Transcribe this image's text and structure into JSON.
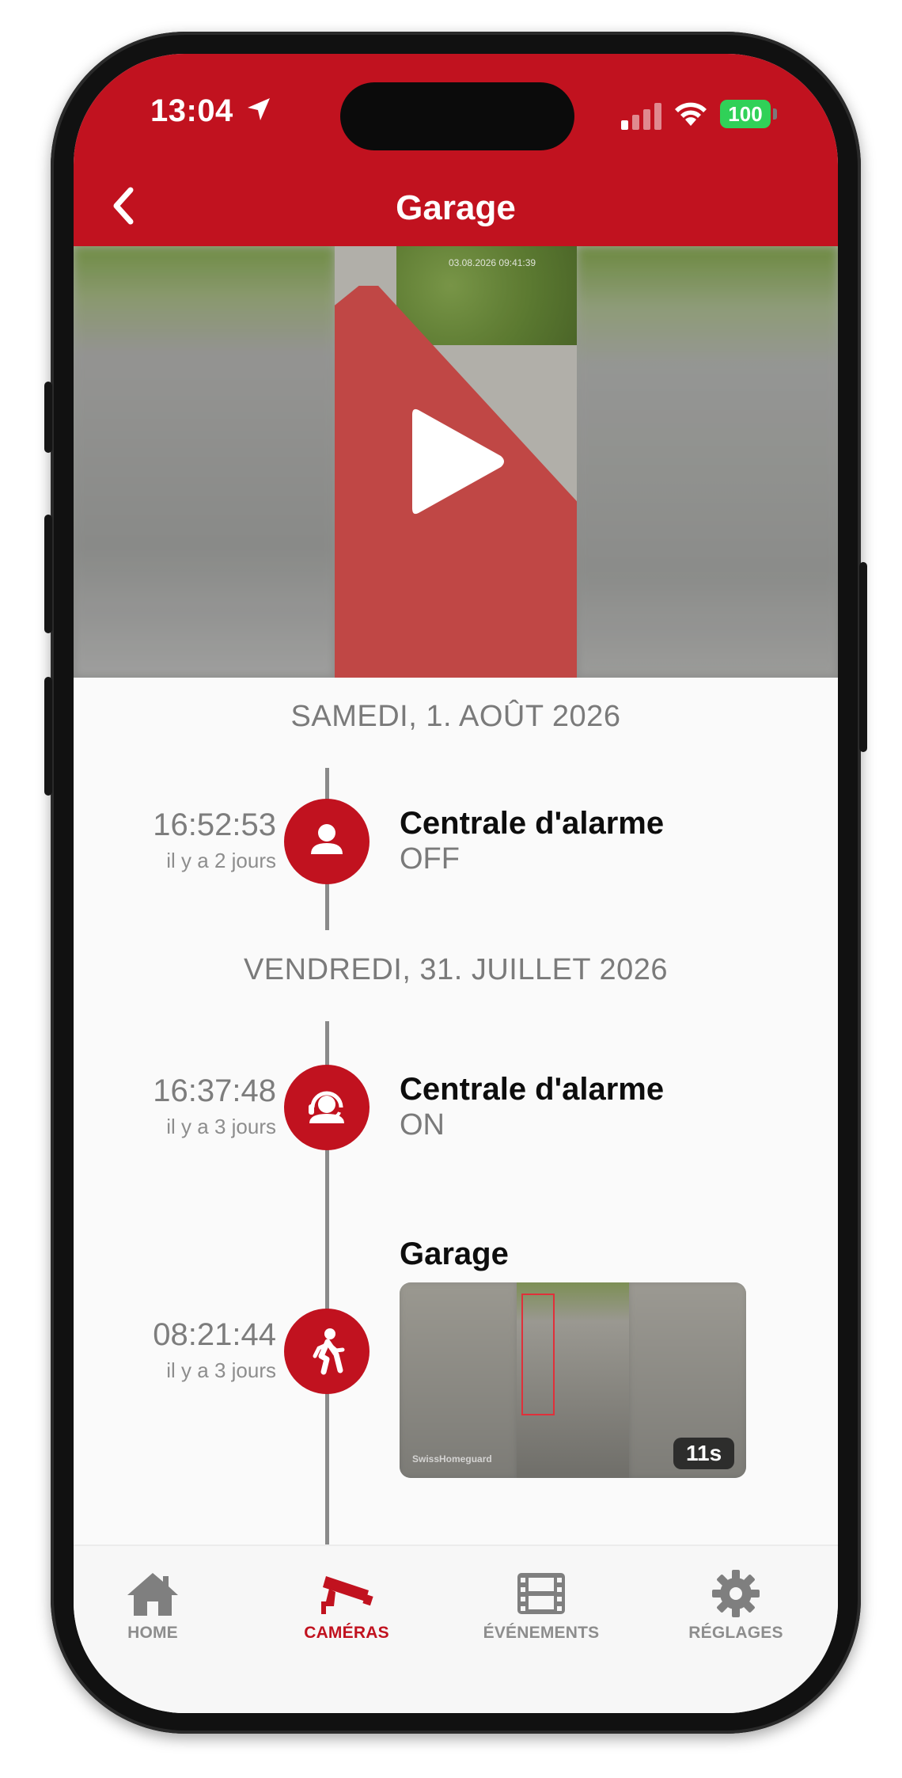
{
  "status_bar": {
    "time": "13:04",
    "battery": "100"
  },
  "header": {
    "title": "Garage",
    "back_icon": "chevron-left-icon"
  },
  "video": {
    "overlay_timestamp": "03.08.2026 09:41:39",
    "play_icon": "play-icon"
  },
  "timeline": {
    "groups": [
      {
        "date": "SAMEDI, 1. AOÛT 2026",
        "events": [
          {
            "time": "16:52:53",
            "ago": "il y a 2 jours",
            "icon": "person-icon",
            "title": "Centrale d'alarme",
            "status": "OFF"
          }
        ]
      },
      {
        "date": "VENDREDI, 31. JUILLET 2026",
        "events": [
          {
            "time": "16:37:48",
            "ago": "il y a 3 jours",
            "icon": "operator-headset-icon",
            "title": "Centrale d'alarme",
            "status": "ON"
          },
          {
            "time": "08:21:44",
            "ago": "il y a 3 jours",
            "icon": "walking-person-icon",
            "title": "Garage",
            "thumbnail_duration": "11s",
            "thumbnail_watermark": "SwissHomeguard"
          }
        ]
      }
    ]
  },
  "tabbar": {
    "tabs": [
      {
        "label": "HOME",
        "icon": "home-icon",
        "active": false
      },
      {
        "label": "CAMÉRAS",
        "icon": "security-camera-icon",
        "active": true
      },
      {
        "label": "ÉVÉNEMENTS",
        "icon": "film-icon",
        "active": false
      },
      {
        "label": "RÉGLAGES",
        "icon": "gear-icon",
        "active": false
      }
    ]
  },
  "colors": {
    "brand_red": "#c1121f",
    "battery_green": "#30d158",
    "muted_gray": "#7a7a7a"
  }
}
